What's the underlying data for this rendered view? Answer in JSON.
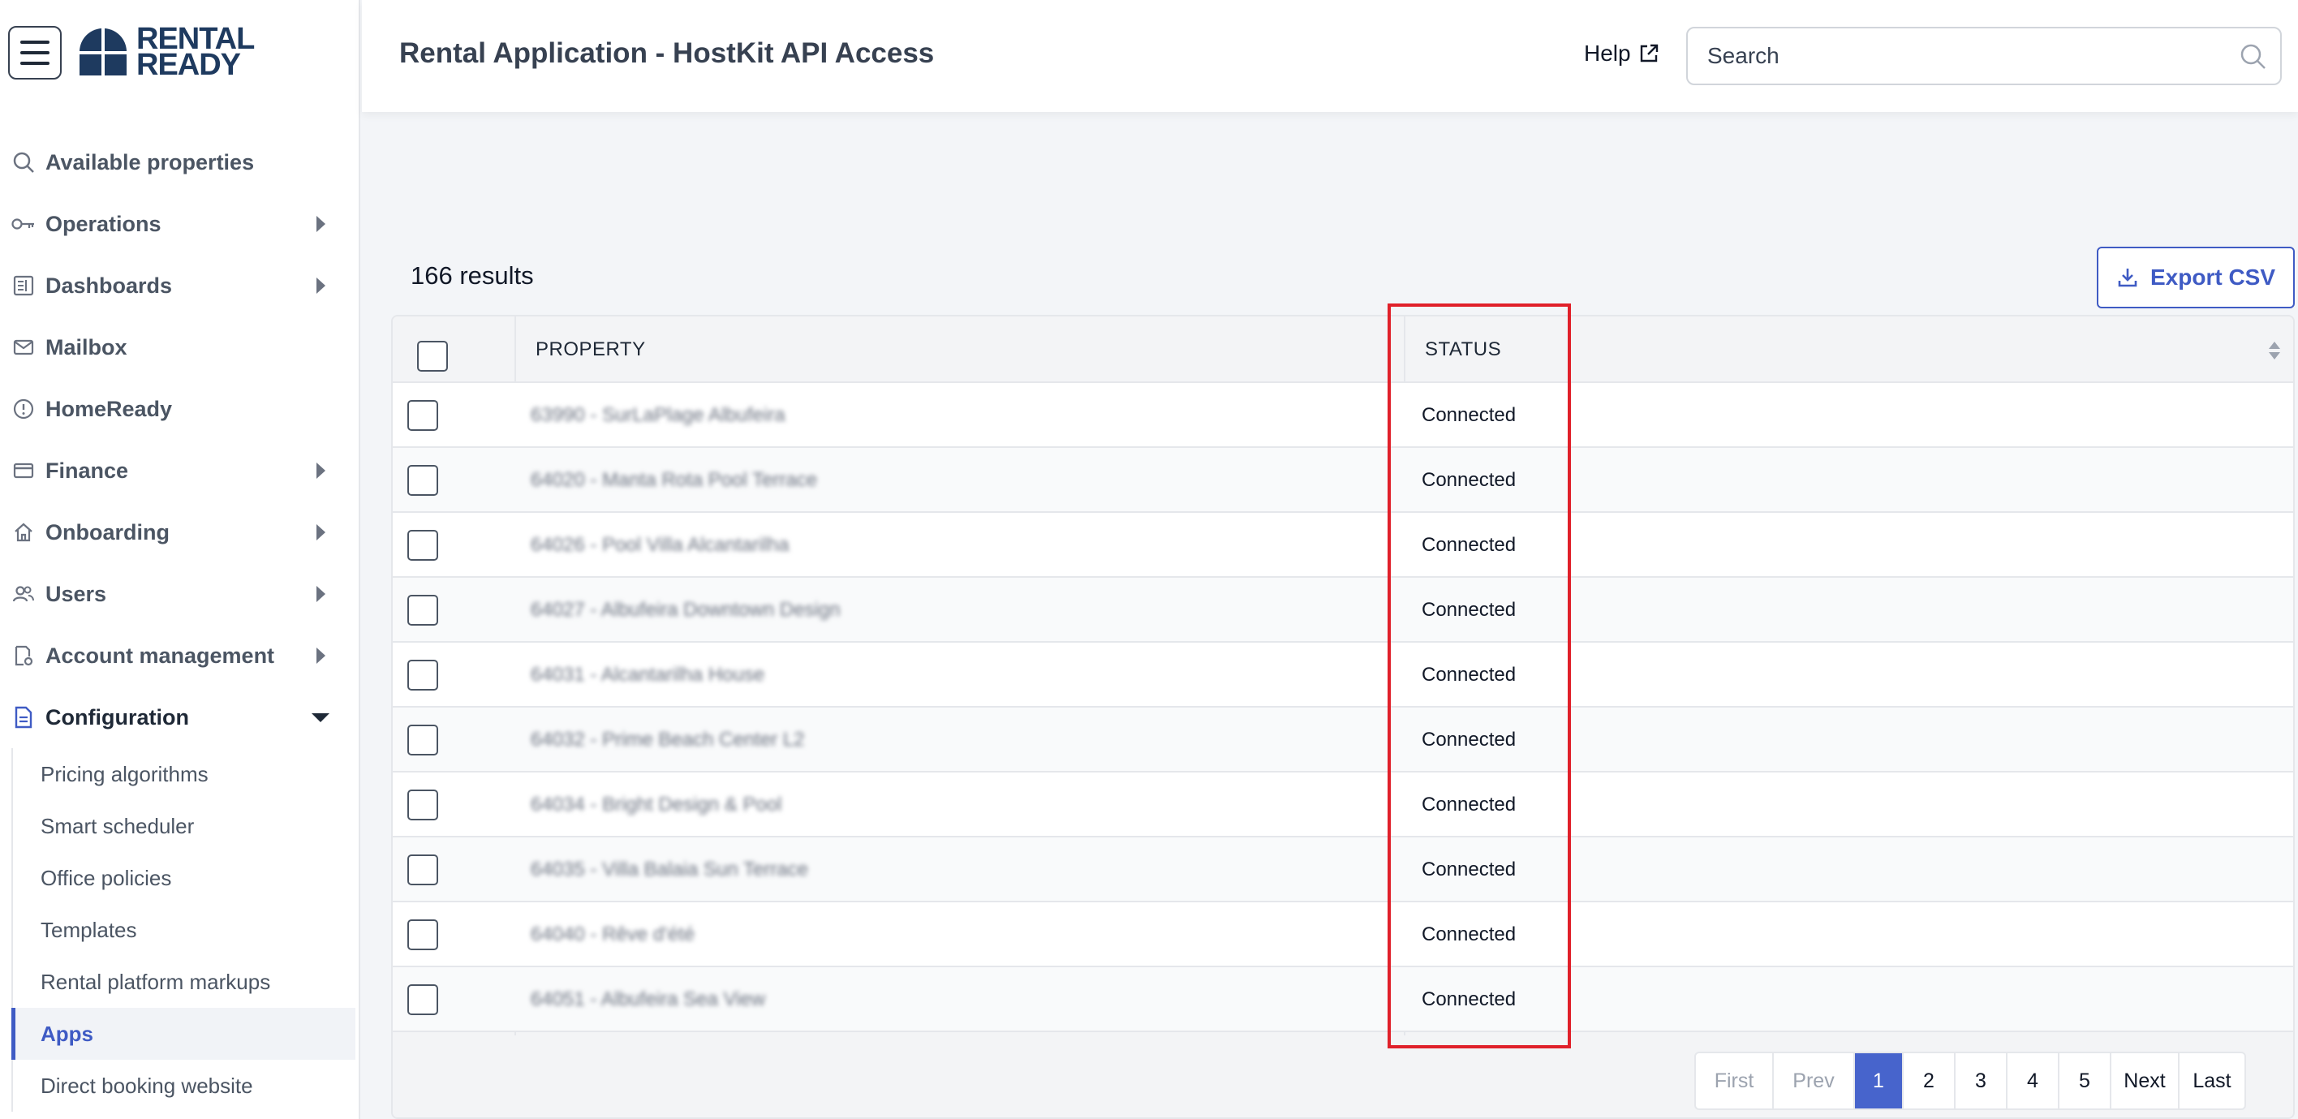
{
  "app": {
    "logo_line1": "RENTAL",
    "logo_line2": "READY"
  },
  "header": {
    "title": "Rental Application - HostKit API Access",
    "help_label": "Help",
    "search_placeholder": "Search"
  },
  "sidebar": {
    "items": [
      {
        "label": "Available properties",
        "icon": "search-icon",
        "has_arrow": false
      },
      {
        "label": "Operations",
        "icon": "key-icon",
        "has_arrow": true
      },
      {
        "label": "Dashboards",
        "icon": "dashboard-icon",
        "has_arrow": true
      },
      {
        "label": "Mailbox",
        "icon": "mail-icon",
        "has_arrow": false
      },
      {
        "label": "HomeReady",
        "icon": "alert-circle-icon",
        "has_arrow": false
      },
      {
        "label": "Finance",
        "icon": "credit-card-icon",
        "has_arrow": true
      },
      {
        "label": "Onboarding",
        "icon": "home-icon",
        "has_arrow": true
      },
      {
        "label": "Users",
        "icon": "users-icon",
        "has_arrow": true
      },
      {
        "label": "Account management",
        "icon": "account-settings-icon",
        "has_arrow": true
      },
      {
        "label": "Configuration",
        "icon": "document-icon",
        "has_arrow": true,
        "expanded": true
      }
    ],
    "sub_items": [
      {
        "label": "Pricing algorithms"
      },
      {
        "label": "Smart scheduler"
      },
      {
        "label": "Office policies"
      },
      {
        "label": "Templates"
      },
      {
        "label": "Rental platform markups"
      },
      {
        "label": "Apps",
        "active": true
      },
      {
        "label": "Direct booking website"
      }
    ]
  },
  "results": {
    "count_label": "166 results",
    "export_label": "Export CSV"
  },
  "table": {
    "columns": {
      "property": "PROPERTY",
      "status": "STATUS"
    },
    "rows": [
      {
        "property": "63990 - SurLaPlage Albufeira",
        "status": "Connected"
      },
      {
        "property": "64020 - Manta Rota Pool Terrace",
        "status": "Connected"
      },
      {
        "property": "64026 - Pool Villa Alcantarilha",
        "status": "Connected"
      },
      {
        "property": "64027 - Albufeira Downtown Design",
        "status": "Connected"
      },
      {
        "property": "64031 - Alcantarilha House",
        "status": "Connected"
      },
      {
        "property": "64032 - Prime Beach Center L2",
        "status": "Connected"
      },
      {
        "property": "64034 - Bright Design & Pool",
        "status": "Connected"
      },
      {
        "property": "64035 - Villa Balaia Sun Terrace",
        "status": "Connected"
      },
      {
        "property": "64040 - Rêve d'été",
        "status": "Connected"
      },
      {
        "property": "64051 - Albufeira Sea View",
        "status": "Connected"
      }
    ]
  },
  "pagination": {
    "first": "First",
    "prev": "Prev",
    "pages": [
      "1",
      "2",
      "3",
      "4",
      "5"
    ],
    "current": "1",
    "next": "Next",
    "last": "Last"
  },
  "colors": {
    "accent": "#4764cc",
    "highlight": "#e0202a",
    "logo": "#1e3a5f"
  }
}
